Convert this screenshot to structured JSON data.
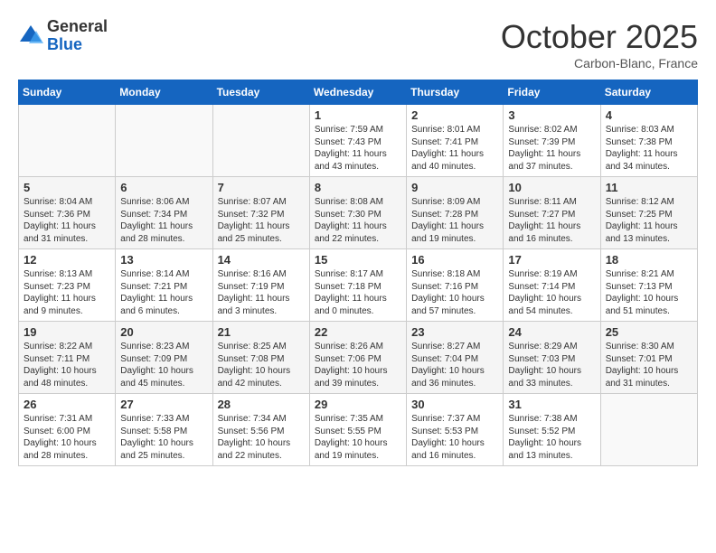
{
  "header": {
    "logo_general": "General",
    "logo_blue": "Blue",
    "month": "October 2025",
    "location": "Carbon-Blanc, France"
  },
  "days_of_week": [
    "Sunday",
    "Monday",
    "Tuesday",
    "Wednesday",
    "Thursday",
    "Friday",
    "Saturday"
  ],
  "weeks": [
    [
      {
        "day": "",
        "info": ""
      },
      {
        "day": "",
        "info": ""
      },
      {
        "day": "",
        "info": ""
      },
      {
        "day": "1",
        "info": "Sunrise: 7:59 AM\nSunset: 7:43 PM\nDaylight: 11 hours and 43 minutes."
      },
      {
        "day": "2",
        "info": "Sunrise: 8:01 AM\nSunset: 7:41 PM\nDaylight: 11 hours and 40 minutes."
      },
      {
        "day": "3",
        "info": "Sunrise: 8:02 AM\nSunset: 7:39 PM\nDaylight: 11 hours and 37 minutes."
      },
      {
        "day": "4",
        "info": "Sunrise: 8:03 AM\nSunset: 7:38 PM\nDaylight: 11 hours and 34 minutes."
      }
    ],
    [
      {
        "day": "5",
        "info": "Sunrise: 8:04 AM\nSunset: 7:36 PM\nDaylight: 11 hours and 31 minutes."
      },
      {
        "day": "6",
        "info": "Sunrise: 8:06 AM\nSunset: 7:34 PM\nDaylight: 11 hours and 28 minutes."
      },
      {
        "day": "7",
        "info": "Sunrise: 8:07 AM\nSunset: 7:32 PM\nDaylight: 11 hours and 25 minutes."
      },
      {
        "day": "8",
        "info": "Sunrise: 8:08 AM\nSunset: 7:30 PM\nDaylight: 11 hours and 22 minutes."
      },
      {
        "day": "9",
        "info": "Sunrise: 8:09 AM\nSunset: 7:28 PM\nDaylight: 11 hours and 19 minutes."
      },
      {
        "day": "10",
        "info": "Sunrise: 8:11 AM\nSunset: 7:27 PM\nDaylight: 11 hours and 16 minutes."
      },
      {
        "day": "11",
        "info": "Sunrise: 8:12 AM\nSunset: 7:25 PM\nDaylight: 11 hours and 13 minutes."
      }
    ],
    [
      {
        "day": "12",
        "info": "Sunrise: 8:13 AM\nSunset: 7:23 PM\nDaylight: 11 hours and 9 minutes."
      },
      {
        "day": "13",
        "info": "Sunrise: 8:14 AM\nSunset: 7:21 PM\nDaylight: 11 hours and 6 minutes."
      },
      {
        "day": "14",
        "info": "Sunrise: 8:16 AM\nSunset: 7:19 PM\nDaylight: 11 hours and 3 minutes."
      },
      {
        "day": "15",
        "info": "Sunrise: 8:17 AM\nSunset: 7:18 PM\nDaylight: 11 hours and 0 minutes."
      },
      {
        "day": "16",
        "info": "Sunrise: 8:18 AM\nSunset: 7:16 PM\nDaylight: 10 hours and 57 minutes."
      },
      {
        "day": "17",
        "info": "Sunrise: 8:19 AM\nSunset: 7:14 PM\nDaylight: 10 hours and 54 minutes."
      },
      {
        "day": "18",
        "info": "Sunrise: 8:21 AM\nSunset: 7:13 PM\nDaylight: 10 hours and 51 minutes."
      }
    ],
    [
      {
        "day": "19",
        "info": "Sunrise: 8:22 AM\nSunset: 7:11 PM\nDaylight: 10 hours and 48 minutes."
      },
      {
        "day": "20",
        "info": "Sunrise: 8:23 AM\nSunset: 7:09 PM\nDaylight: 10 hours and 45 minutes."
      },
      {
        "day": "21",
        "info": "Sunrise: 8:25 AM\nSunset: 7:08 PM\nDaylight: 10 hours and 42 minutes."
      },
      {
        "day": "22",
        "info": "Sunrise: 8:26 AM\nSunset: 7:06 PM\nDaylight: 10 hours and 39 minutes."
      },
      {
        "day": "23",
        "info": "Sunrise: 8:27 AM\nSunset: 7:04 PM\nDaylight: 10 hours and 36 minutes."
      },
      {
        "day": "24",
        "info": "Sunrise: 8:29 AM\nSunset: 7:03 PM\nDaylight: 10 hours and 33 minutes."
      },
      {
        "day": "25",
        "info": "Sunrise: 8:30 AM\nSunset: 7:01 PM\nDaylight: 10 hours and 31 minutes."
      }
    ],
    [
      {
        "day": "26",
        "info": "Sunrise: 7:31 AM\nSunset: 6:00 PM\nDaylight: 10 hours and 28 minutes."
      },
      {
        "day": "27",
        "info": "Sunrise: 7:33 AM\nSunset: 5:58 PM\nDaylight: 10 hours and 25 minutes."
      },
      {
        "day": "28",
        "info": "Sunrise: 7:34 AM\nSunset: 5:56 PM\nDaylight: 10 hours and 22 minutes."
      },
      {
        "day": "29",
        "info": "Sunrise: 7:35 AM\nSunset: 5:55 PM\nDaylight: 10 hours and 19 minutes."
      },
      {
        "day": "30",
        "info": "Sunrise: 7:37 AM\nSunset: 5:53 PM\nDaylight: 10 hours and 16 minutes."
      },
      {
        "day": "31",
        "info": "Sunrise: 7:38 AM\nSunset: 5:52 PM\nDaylight: 10 hours and 13 minutes."
      },
      {
        "day": "",
        "info": ""
      }
    ]
  ]
}
